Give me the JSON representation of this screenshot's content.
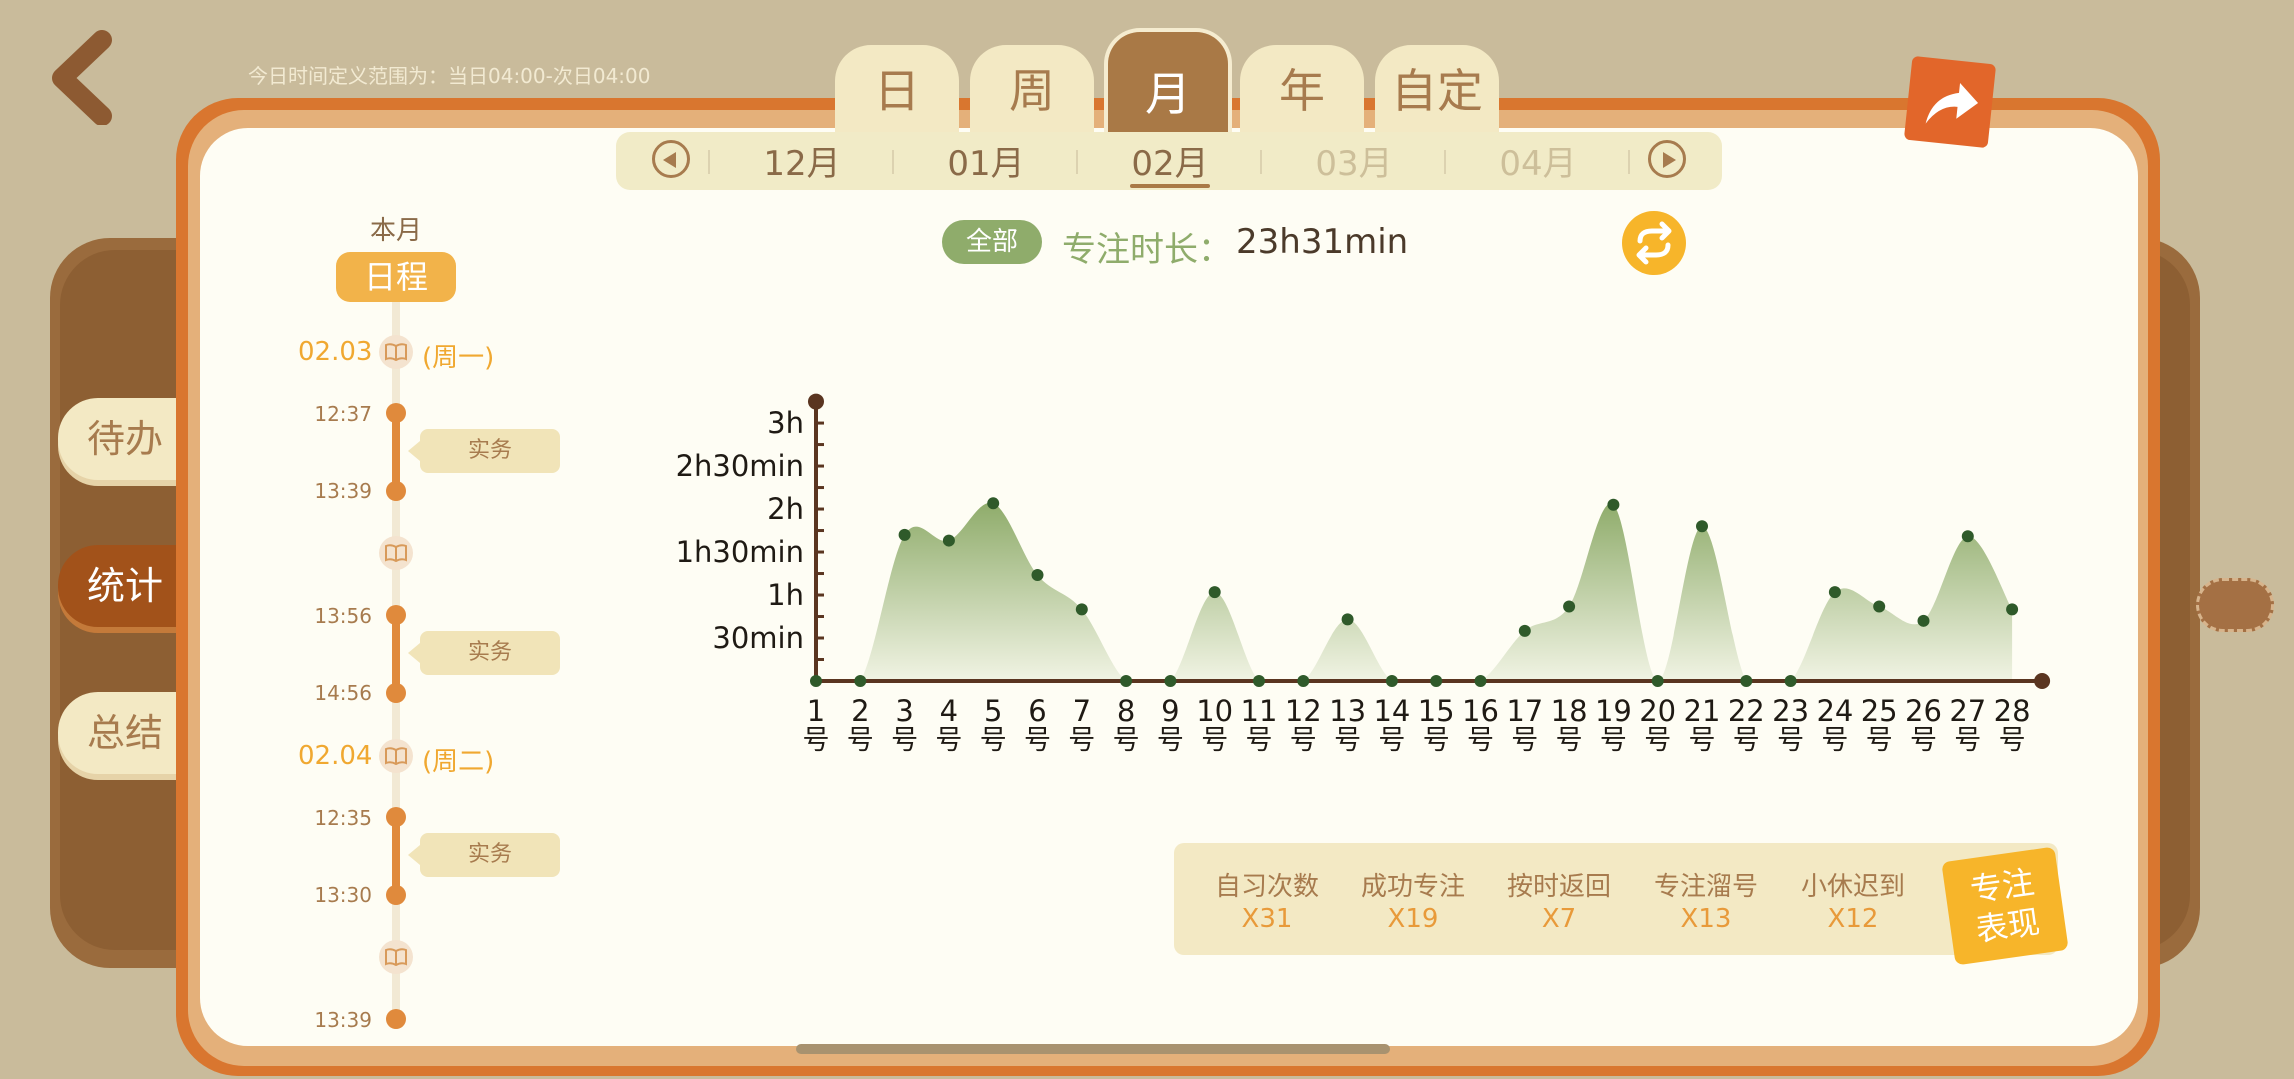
{
  "header": {
    "time_definition": "今日时间定义范围为：当日04:00-次日04:00"
  },
  "tabs": [
    {
      "label": "日",
      "active": false
    },
    {
      "label": "周",
      "active": false
    },
    {
      "label": "月",
      "active": true
    },
    {
      "label": "年",
      "active": false
    },
    {
      "label": "自定",
      "active": false
    }
  ],
  "months": [
    {
      "label": "12月",
      "state": "normal"
    },
    {
      "label": "01月",
      "state": "normal"
    },
    {
      "label": "02月",
      "state": "active"
    },
    {
      "label": "03月",
      "state": "faded"
    },
    {
      "label": "04月",
      "state": "faded"
    }
  ],
  "side_tabs": [
    {
      "label": "待办",
      "active": false
    },
    {
      "label": "统计",
      "active": true
    },
    {
      "label": "总结",
      "active": false
    }
  ],
  "schedule": {
    "this_month": "本月",
    "title": "日程",
    "day1": {
      "date": "02.03",
      "weekday": "(周一)"
    },
    "day2": {
      "date": "02.04",
      "weekday": "(周二)"
    },
    "entries": [
      {
        "start": "12:37",
        "end": "13:39",
        "task": "实务"
      },
      {
        "start": "13:56",
        "end": "14:56",
        "task": "实务"
      },
      {
        "start": "12:35",
        "end": "13:30",
        "task": "实务"
      }
    ],
    "last_time": "13:39"
  },
  "summary": {
    "filter_label": "全部",
    "focus_label": "专注时长：",
    "focus_value": "23h31min"
  },
  "chart_data": {
    "type": "area",
    "x": [
      "1号",
      "2号",
      "3号",
      "4号",
      "5号",
      "6号",
      "7号",
      "8号",
      "9号",
      "10号",
      "11号",
      "12号",
      "13号",
      "14号",
      "15号",
      "16号",
      "17号",
      "18号",
      "19号",
      "20号",
      "21号",
      "22号",
      "23号",
      "24号",
      "25号",
      "26号",
      "27号",
      "28号"
    ],
    "y_minutes": [
      0,
      0,
      102,
      98,
      124,
      74,
      50,
      0,
      0,
      62,
      0,
      0,
      43,
      0,
      0,
      0,
      35,
      52,
      123,
      0,
      108,
      0,
      0,
      62,
      52,
      42,
      101,
      50
    ],
    "y_ticks": [
      "30min",
      "1h",
      "1h30min",
      "2h",
      "2h30min",
      "3h"
    ],
    "y_tick_minutes": [
      30,
      60,
      90,
      120,
      150,
      180
    ],
    "ylim_minutes": [
      0,
      195
    ],
    "color": "#8fac6b"
  },
  "stats": [
    {
      "label": "自习次数",
      "value": "X31"
    },
    {
      "label": "成功专注",
      "value": "X19"
    },
    {
      "label": "按时返回",
      "value": "X7"
    },
    {
      "label": "专注溜号",
      "value": "X13"
    },
    {
      "label": "小休迟到",
      "value": "X12"
    }
  ],
  "performance_label_1": "专注",
  "performance_label_2": "表现"
}
